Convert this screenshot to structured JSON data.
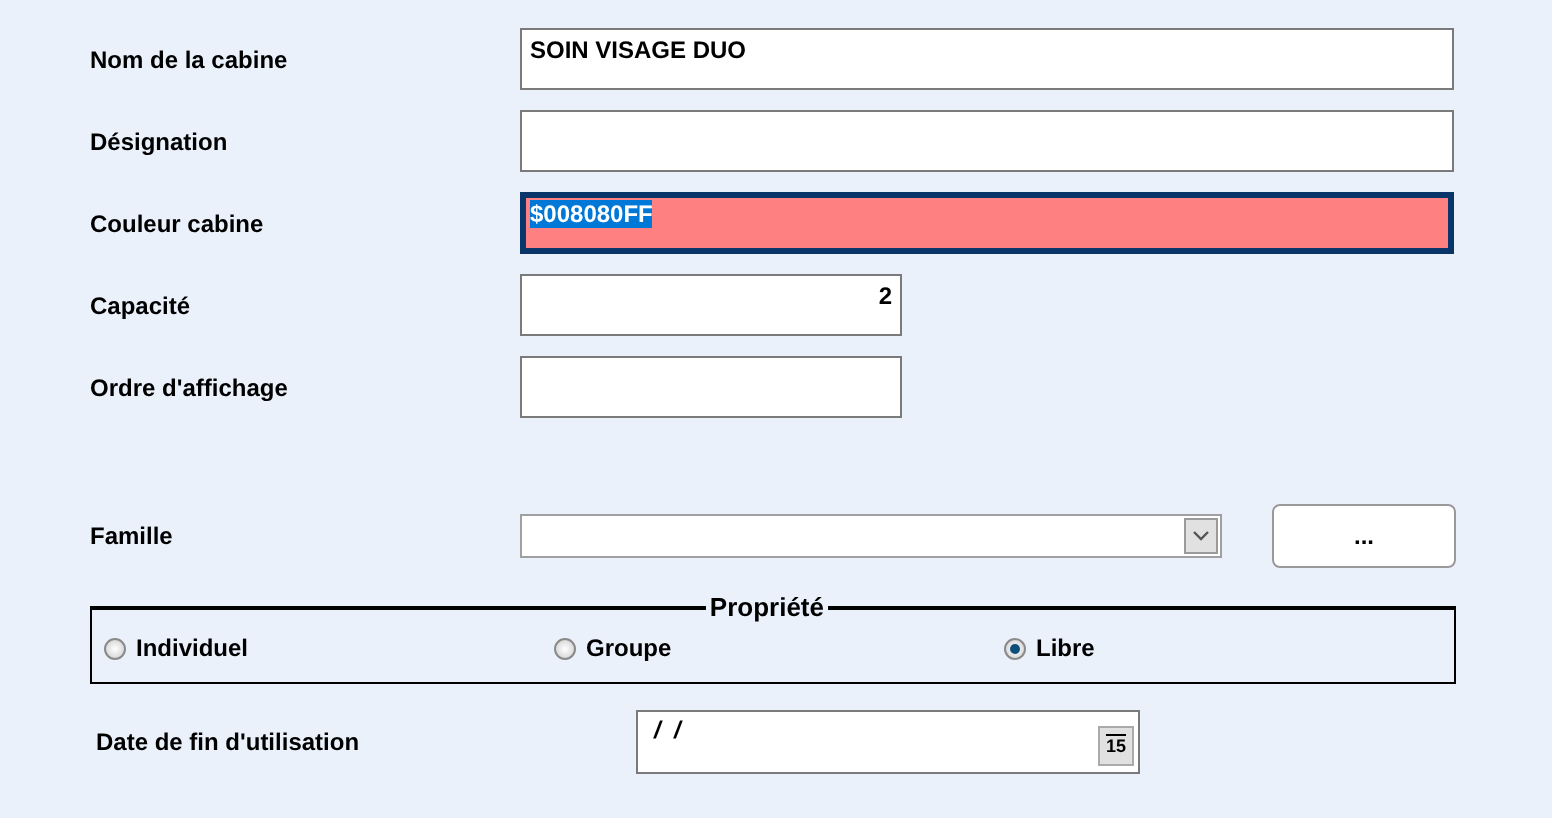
{
  "fields": [
    {
      "label": "Nom de la cabine",
      "kind": "text",
      "value": "SOIN VISAGE DUO"
    },
    {
      "label": "Désignation",
      "kind": "text"
    },
    {
      "label": "Couleur cabine",
      "kind": "color",
      "value": "$008080FF",
      "color": "#ff8080",
      "text_selected": true
    },
    {
      "label": "Capacité",
      "kind": "number",
      "value": "2"
    },
    {
      "label": "Ordre d'affichage",
      "kind": "number"
    }
  ],
  "famille": {
    "label": "Famille",
    "browse_button": "..."
  },
  "propriete": {
    "title": "Propriété",
    "options": [
      {
        "label": "Individuel",
        "selected": false
      },
      {
        "label": "Groupe",
        "selected": false
      },
      {
        "label": "Libre",
        "selected": true
      }
    ]
  },
  "date_fin": {
    "label": "Date de fin d'utilisation",
    "value": "/  /",
    "calendar_button": "15"
  }
}
